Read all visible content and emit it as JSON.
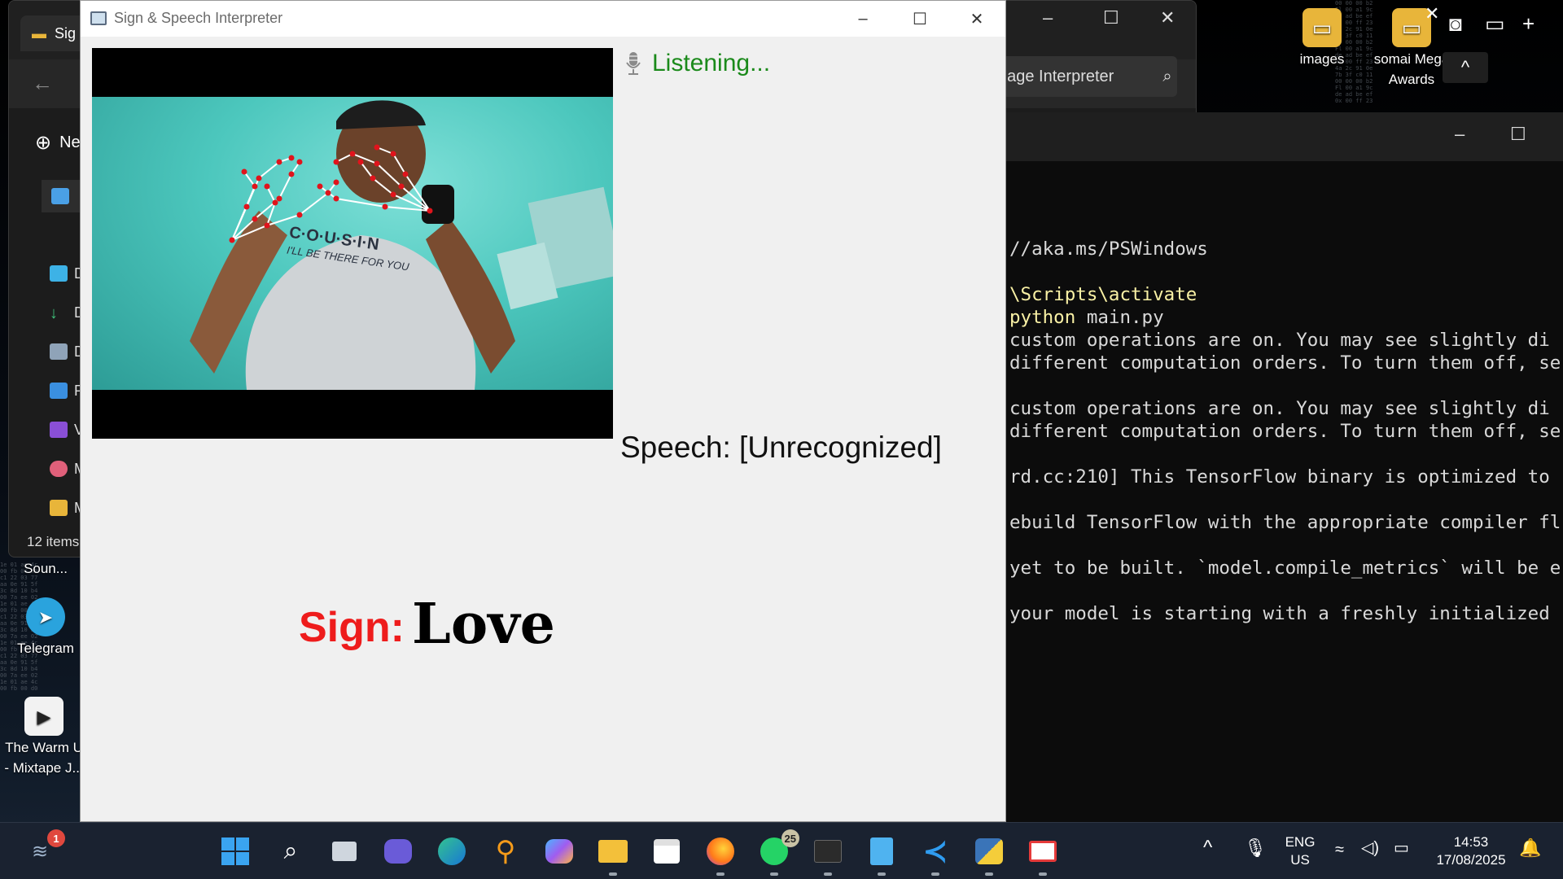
{
  "app": {
    "title": "Sign & Speech Interpreter",
    "status": "Listening...",
    "speech_label": "Speech: [Unrecognized]",
    "sign_label": "Sign:",
    "sign_value": "Love",
    "shirt_text_1": "C·O·U·S·I·N",
    "shirt_text_2": "I'LL BE THERE FOR YOU",
    "status_color": "#1b8a1b",
    "sign_label_color": "#ee1c1c"
  },
  "explorer": {
    "tab_title": "Sig",
    "new_label": "Ne",
    "search_text": "uage Interpreter",
    "nav_items": [
      "D",
      "D",
      "D",
      "P",
      "V",
      "M",
      "M"
    ],
    "item_count": "12 items"
  },
  "terminal": {
    "lines": [
      {
        "text": "//aka.ms/PSWindows",
        "style": "normal"
      },
      {
        "text": "",
        "style": "normal"
      },
      {
        "text": "\\Scripts\\activate",
        "style": "yellow"
      },
      {
        "text": "python main.py",
        "style": "yellow-cmd"
      },
      {
        "text": "custom operations are on. You may see slightly di",
        "style": "normal"
      },
      {
        "text": "different computation orders. To turn them off, se",
        "style": "normal"
      },
      {
        "text": "",
        "style": "normal"
      },
      {
        "text": "custom operations are on. You may see slightly di",
        "style": "normal"
      },
      {
        "text": "different computation orders. To turn them off, se",
        "style": "normal"
      },
      {
        "text": "",
        "style": "normal"
      },
      {
        "text": "rd.cc:210] This TensorFlow binary is optimized to",
        "style": "normal"
      },
      {
        "text": "",
        "style": "normal"
      },
      {
        "text": "ebuild TensorFlow with the appropriate compiler fl",
        "style": "normal"
      },
      {
        "text": "",
        "style": "normal"
      },
      {
        "text": "yet to be built. `model.compile_metrics` will be e",
        "style": "normal"
      },
      {
        "text": "",
        "style": "normal"
      },
      {
        "text": "your model is starting with a freshly initialized",
        "style": "normal"
      }
    ]
  },
  "desktop_icons": {
    "images": "images",
    "somai_1": "somai Mega",
    "somai_2": "Awards",
    "sound": "Soun...",
    "telegram": "Telegram",
    "warm_1": "The Warm U",
    "warm_2": "- Mixtape J..."
  },
  "taskbar": {
    "notification_badge": "1",
    "whatsapp_badge": "25",
    "lang_1": "ENG",
    "lang_2": "US",
    "time": "14:53",
    "date": "17/08/2025"
  }
}
